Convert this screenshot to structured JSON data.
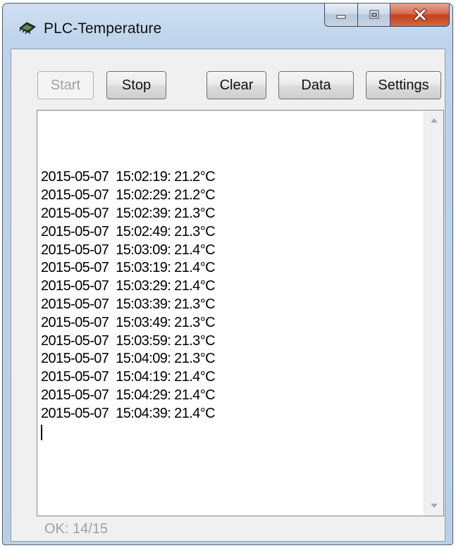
{
  "window": {
    "title": "PLC-Temperature",
    "icon": "plc-chip-icon",
    "controls": [
      "minimize-icon",
      "maximize-icon",
      "close-icon"
    ]
  },
  "toolbar": {
    "start_label": "Start",
    "start_enabled": false,
    "stop_label": "Stop",
    "clear_label": "Clear",
    "data_label": "Data",
    "settings_label": "Settings"
  },
  "log": {
    "lines": [
      "2015-05-07  15:02:19: 21.2°C",
      "2015-05-07  15:02:29: 21.2°C",
      "2015-05-07  15:02:39: 21.3°C",
      "2015-05-07  15:02:49: 21.3°C",
      "2015-05-07  15:03:09: 21.4°C",
      "2015-05-07  15:03:19: 21.4°C",
      "2015-05-07  15:03:29: 21.4°C",
      "2015-05-07  15:03:39: 21.3°C",
      "2015-05-07  15:03:49: 21.3°C",
      "2015-05-07  15:03:59: 21.3°C",
      "2015-05-07  15:04:09: 21.3°C",
      "2015-05-07  15:04:19: 21.4°C",
      "2015-05-07  15:04:29: 21.4°C",
      "2015-05-07  15:04:39: 21.4°C"
    ]
  },
  "status": {
    "text": "OK: 14/15"
  },
  "colors": {
    "close_button": "#c4401f",
    "title_bar": "#bcd3eb",
    "disabled_text": "#a0a0a0"
  }
}
